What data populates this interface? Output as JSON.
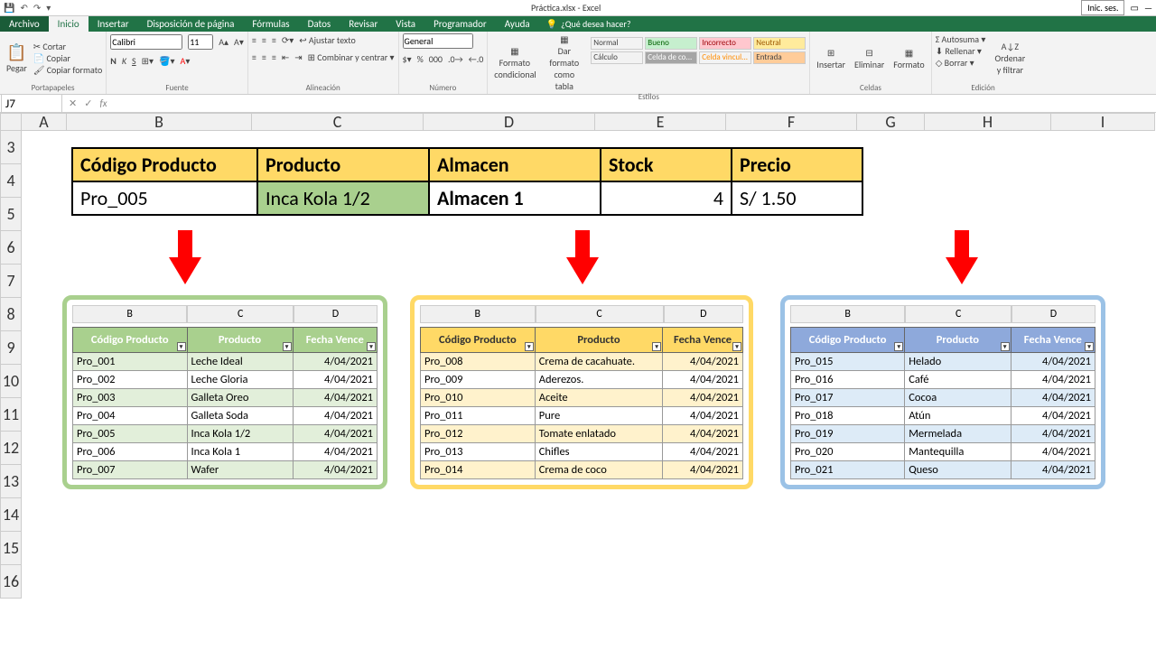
{
  "titlebar": {
    "title": "Práctica.xlsx - Excel",
    "signin": "Inic. ses."
  },
  "tabs": [
    "Archivo",
    "Inicio",
    "Insertar",
    "Disposición de página",
    "Fórmulas",
    "Datos",
    "Revisar",
    "Vista",
    "Programador",
    "Ayuda"
  ],
  "tell": "¿Qué desea hacer?",
  "ribbon": {
    "clipboard": {
      "paste": "Pegar",
      "cut": "Cortar",
      "copy": "Copiar",
      "format": "Copiar formato",
      "label": "Portapapeles"
    },
    "font": {
      "name": "Calibri",
      "size": "11",
      "label": "Fuente"
    },
    "align": {
      "wrap": "Ajustar texto",
      "merge": "Combinar y centrar",
      "label": "Alineación"
    },
    "number": {
      "format": "General",
      "label": "Número"
    },
    "styles": {
      "cond": "Formato condicional",
      "table": "Dar formato como tabla",
      "s1": "Normal",
      "s2": "Bueno",
      "s3": "Incorrecto",
      "s4": "Neutral",
      "s5": "Cálculo",
      "s6": "Celda de co...",
      "s7": "Celda vincul...",
      "s8": "Entrada",
      "label": "Estilos"
    },
    "cells": {
      "insert": "Insertar",
      "delete": "Eliminar",
      "format": "Formato",
      "label": "Celdas"
    },
    "edit": {
      "sum": "Autosuma",
      "fill": "Rellenar",
      "clear": "Borrar",
      "sort": "Ordenar y filtrar",
      "label": "Edición"
    }
  },
  "namebox": "J7",
  "cols_main": [
    "A",
    "B",
    "C",
    "D",
    "E",
    "F",
    "G",
    "H",
    "I"
  ],
  "rows_main": [
    "3",
    "4",
    "5",
    "6",
    "7",
    "8",
    "9",
    "10",
    "11",
    "12",
    "13",
    "14",
    "15",
    "16"
  ],
  "lookup": {
    "headers": [
      "Código Producto",
      "Producto",
      "Almacen",
      "Stock",
      "Precio"
    ],
    "row": [
      "Pro_005",
      "Inca Kola 1/2",
      "Almacen 1",
      "4",
      "S/      1.50"
    ]
  },
  "mini_cols": [
    "B",
    "C",
    "D"
  ],
  "mini_headers": [
    "Código Producto",
    "Producto",
    "Fecha Vence"
  ],
  "table1": [
    [
      "Pro_001",
      "Leche Ideal",
      "4/04/2021"
    ],
    [
      "Pro_002",
      "Leche Gloria",
      "4/04/2021"
    ],
    [
      "Pro_003",
      "Galleta Oreo",
      "4/04/2021"
    ],
    [
      "Pro_004",
      "Galleta Soda",
      "4/04/2021"
    ],
    [
      "Pro_005",
      "Inca Kola 1/2",
      "4/04/2021"
    ],
    [
      "Pro_006",
      "Inca Kola 1",
      "4/04/2021"
    ],
    [
      "Pro_007",
      "Wafer",
      "4/04/2021"
    ]
  ],
  "table2": [
    [
      "Pro_008",
      "Crema de cacahuate.",
      "4/04/2021"
    ],
    [
      "Pro_009",
      "Aderezos.",
      "4/04/2021"
    ],
    [
      "Pro_010",
      "Aceite",
      "4/04/2021"
    ],
    [
      "Pro_011",
      "Pure",
      "4/04/2021"
    ],
    [
      "Pro_012",
      "Tomate enlatado",
      "4/04/2021"
    ],
    [
      "Pro_013",
      "Chifles",
      "4/04/2021"
    ],
    [
      "Pro_014",
      "Crema de coco",
      "4/04/2021"
    ]
  ],
  "table3": [
    [
      "Pro_015",
      "Helado",
      "4/04/2021"
    ],
    [
      "Pro_016",
      "Café",
      "4/04/2021"
    ],
    [
      "Pro_017",
      "Cocoa",
      "4/04/2021"
    ],
    [
      "Pro_018",
      "Atún",
      "4/04/2021"
    ],
    [
      "Pro_019",
      "Mermelada",
      "4/04/2021"
    ],
    [
      "Pro_020",
      "Mantequilla",
      "4/04/2021"
    ],
    [
      "Pro_021",
      "Queso",
      "4/04/2021"
    ]
  ]
}
